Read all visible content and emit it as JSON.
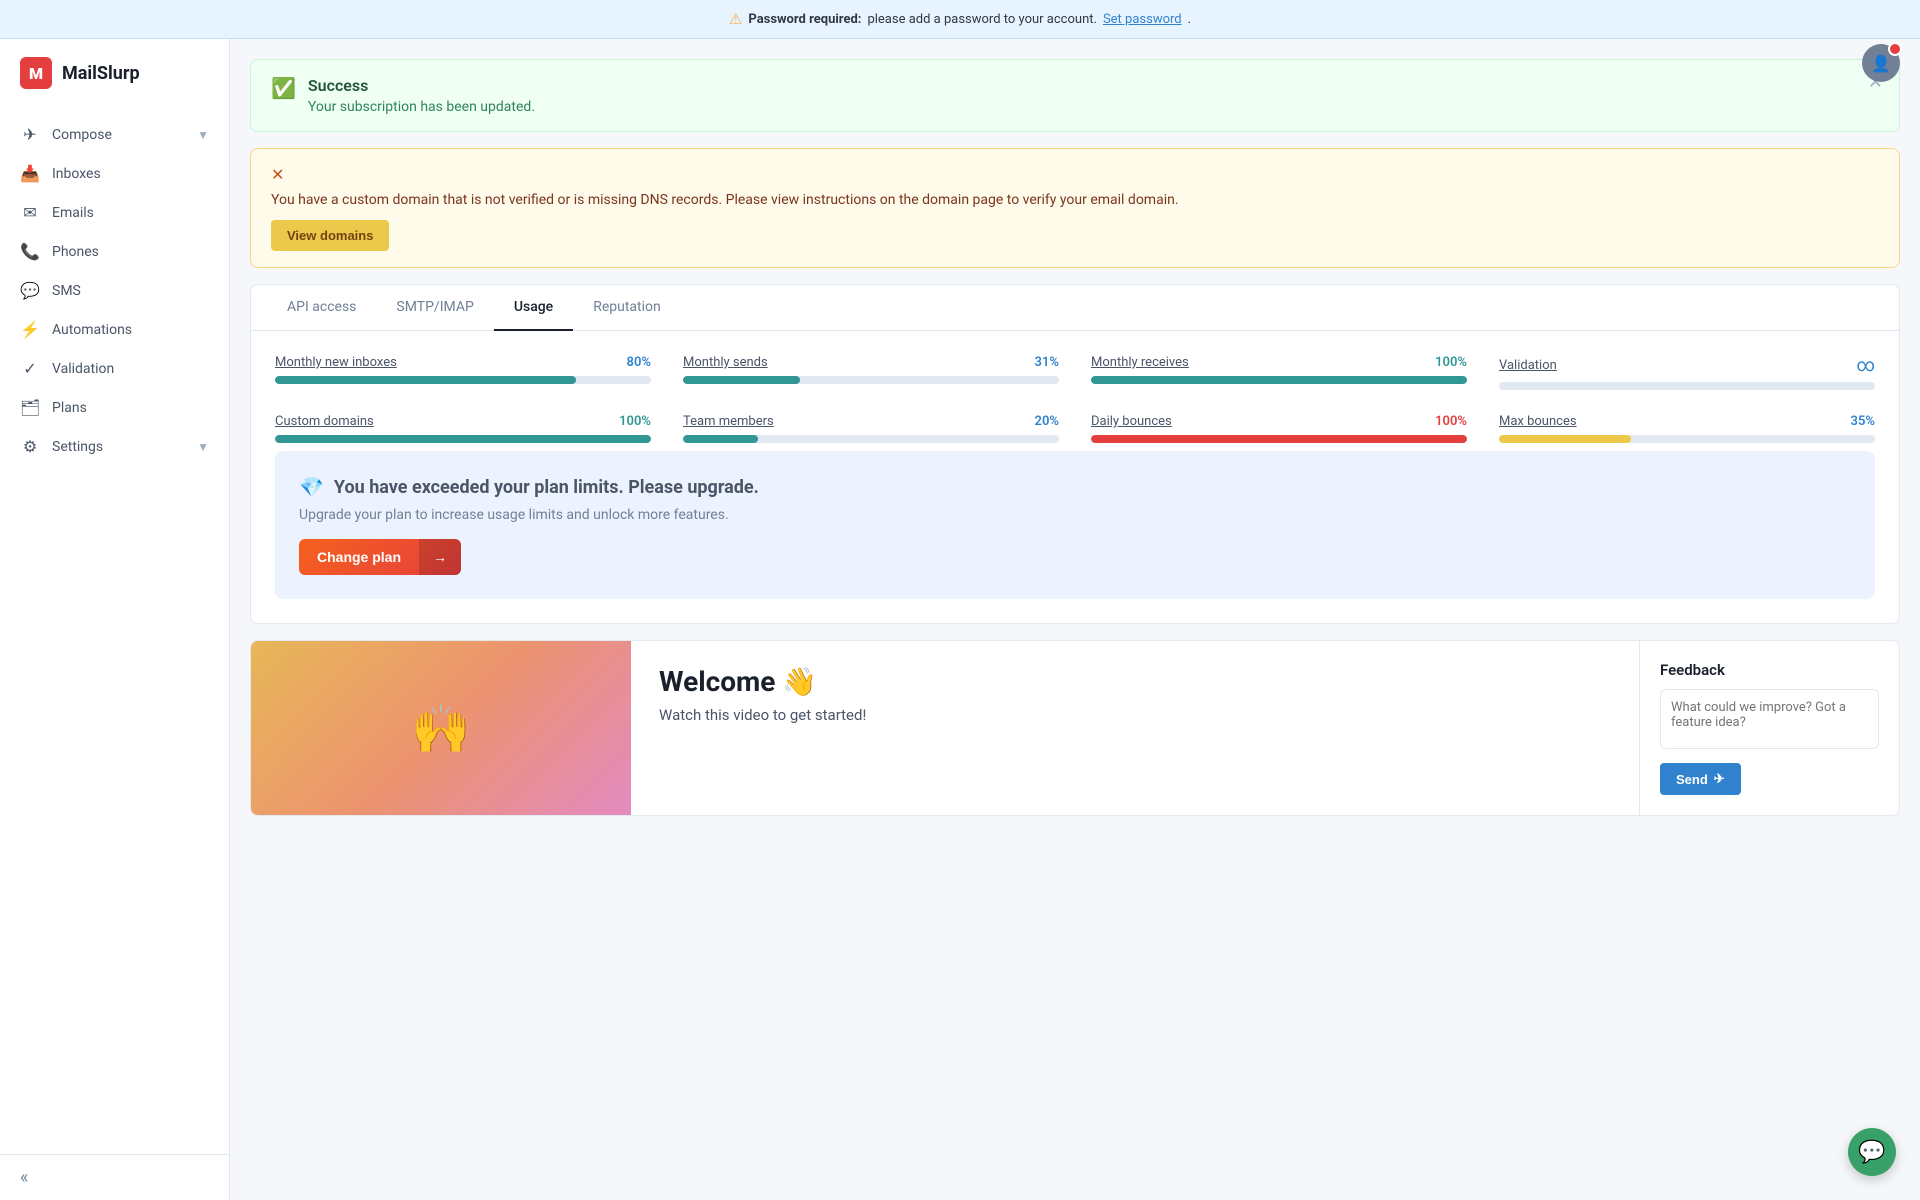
{
  "app": {
    "name": "MailSlurp",
    "logo_letter": "M"
  },
  "top_banner": {
    "warning_text": "Password required:",
    "message": " please add a password to your account.",
    "link_text": "Set password",
    "link_suffix": " ."
  },
  "sidebar": {
    "items": [
      {
        "id": "compose",
        "label": "Compose",
        "icon": "✈",
        "has_arrow": true
      },
      {
        "id": "inboxes",
        "label": "Inboxes",
        "icon": "📥",
        "has_arrow": false
      },
      {
        "id": "emails",
        "label": "Emails",
        "icon": "📧",
        "has_arrow": false
      },
      {
        "id": "phones",
        "label": "Phones",
        "icon": "📞",
        "has_arrow": false
      },
      {
        "id": "sms",
        "label": "SMS",
        "icon": "💬",
        "has_arrow": false
      },
      {
        "id": "automations",
        "label": "Automations",
        "icon": "⚡",
        "has_arrow": false
      },
      {
        "id": "validation",
        "label": "Validation",
        "icon": "✓",
        "has_arrow": false
      },
      {
        "id": "plans",
        "label": "Plans",
        "icon": "🗂",
        "has_arrow": false
      },
      {
        "id": "settings",
        "label": "Settings",
        "icon": "⚙",
        "has_arrow": true
      }
    ],
    "collapse_icon": "«"
  },
  "success_banner": {
    "title": "Success",
    "message": "Your subscription has been updated."
  },
  "warning_banner": {
    "text": "You have a custom domain that is not verified or is missing DNS records. Please view instructions on the domain page to verify your email domain.",
    "button_label": "View domains"
  },
  "tabs": [
    {
      "id": "api-access",
      "label": "API access"
    },
    {
      "id": "smtp-imap",
      "label": "SMTP/IMAP"
    },
    {
      "id": "usage",
      "label": "Usage",
      "active": true
    },
    {
      "id": "reputation",
      "label": "Reputation"
    }
  ],
  "usage": {
    "items": [
      {
        "label": "Monthly new inboxes",
        "pct": "80%",
        "fill": 80,
        "color": "teal"
      },
      {
        "label": "Monthly sends",
        "pct": "31%",
        "fill": 31,
        "color": "teal"
      },
      {
        "label": "Monthly receives",
        "pct": "100%",
        "fill": 100,
        "color": "teal"
      },
      {
        "label": "Validation",
        "pct": "∞",
        "fill": 0,
        "color": "infinity"
      },
      {
        "label": "Custom domains",
        "pct": "100%",
        "fill": 100,
        "color": "teal"
      },
      {
        "label": "Team members",
        "pct": "20%",
        "fill": 20,
        "color": "teal"
      },
      {
        "label": "Daily bounces",
        "pct": "100%",
        "fill": 100,
        "color": "red"
      },
      {
        "label": "Max bounces",
        "pct": "35%",
        "fill": 35,
        "color": "yellow"
      }
    ]
  },
  "upgrade": {
    "title": "You have exceeded your plan limits. Please upgrade.",
    "subtitle": "Upgrade your plan to increase usage limits and unlock more features.",
    "button_label": "Change plan",
    "button_arrow": "→"
  },
  "welcome": {
    "title": "Welcome 👋",
    "subtitle": "Watch this video to get started!"
  },
  "feedback": {
    "title": "Feedback",
    "placeholder": "What could we improve? Got a feature idea?",
    "send_label": "Send"
  }
}
